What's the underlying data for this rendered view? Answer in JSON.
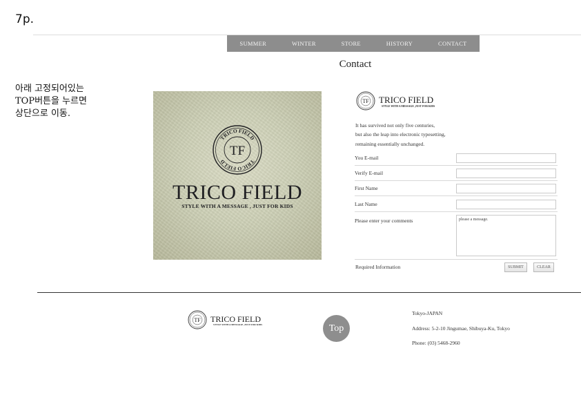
{
  "page_label": "7p.",
  "nav": {
    "items": [
      "SUMMER",
      "WINTER",
      "STORE",
      "HISTORY",
      "CONTACT"
    ],
    "bg": "#8d8d8d"
  },
  "title": "Contact",
  "note": {
    "lines": [
      "아래 고정되어있는",
      "TOP버튼을 누르면",
      "상단으로 이동."
    ]
  },
  "hero": {
    "brand": "TRICO FIELD",
    "tagline": "STYLE WITH A MESSAGE , JUST FOR KIDS",
    "seal_monogram": "TF",
    "seal_ring": "TRICO FIELD"
  },
  "logo": {
    "wordmark": "TRICO FIELD",
    "tagline": "STYLE WITH A MESSAGE ,JUST FOR KIDS",
    "monogram": "TF"
  },
  "form": {
    "intro": [
      "It has survived not only five centuries,",
      "but also the leap into electronic typesetting,",
      "remaining essentially unchanged."
    ],
    "fields": {
      "email": {
        "label": "You E-mail",
        "value": ""
      },
      "verify_email": {
        "label": "Verify E-mail",
        "value": ""
      },
      "first_name": {
        "label": "First Name",
        "value": ""
      },
      "last_name": {
        "label": "Last Name",
        "value": ""
      },
      "comments": {
        "label": "Please enter your comments",
        "value": "please a message."
      }
    },
    "required_label": "Required Information",
    "submit_label": "SUBMIT",
    "clear_label": "CLEAR"
  },
  "footer": {
    "top_label": "Top",
    "address": {
      "line1": "Tokyo-JAPAN",
      "line2": "Address: 5-2-10 Jingumae, Shibuya-Ku, Tokyo",
      "line3": "Phone: (03) 5468-2960"
    }
  },
  "colors": {
    "accent_gray": "#8e8e8e",
    "text_dark": "#222222"
  }
}
